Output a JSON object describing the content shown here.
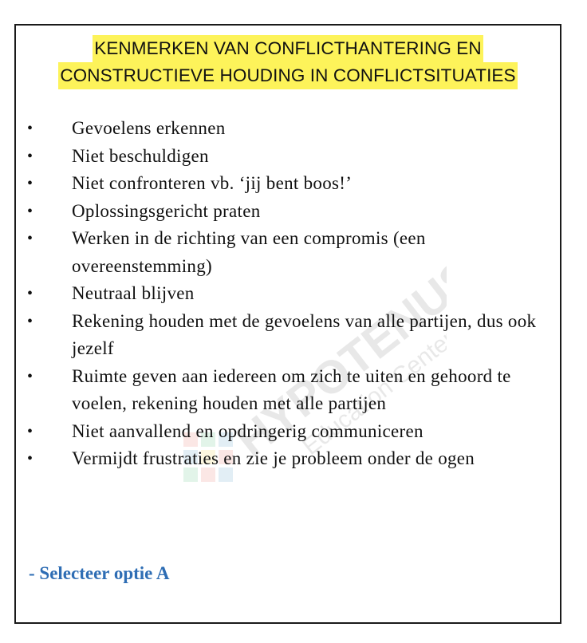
{
  "title": {
    "line1": "KENMERKEN VAN CONFLICTHANTERING EN ",
    "line2": "CONSTRUCTIEVE HOUDING IN CONFLICTSITUATIES"
  },
  "items": [
    "Gevoelens erkennen",
    "Niet beschuldigen",
    "Niet confronteren vb. ‘jij bent boos!’",
    "Oplossingsgericht praten",
    "Werken in de richting van een compromis (een overeenstemming)",
    "Neutraal blijven",
    "Rekening houden met de gevoelens van alle partijen, dus ook jezelf",
    "Ruimte geven aan iedereen om zich te uiten en gehoord te voelen, rekening houden met alle partijen",
    "Niet aanvallend en opdringerig communiceren",
    "Vermijdt frustraties en zie je probleem onder de ogen"
  ],
  "bullet_symbol": "•",
  "answer": "- Selecteer optie A",
  "watermark": {
    "brand": "HYPOTENUSE",
    "tagline": "Education Center"
  },
  "colors": {
    "highlight": "#fdf35a",
    "answer": "#2e6db4",
    "border": "#1a1a1a"
  }
}
